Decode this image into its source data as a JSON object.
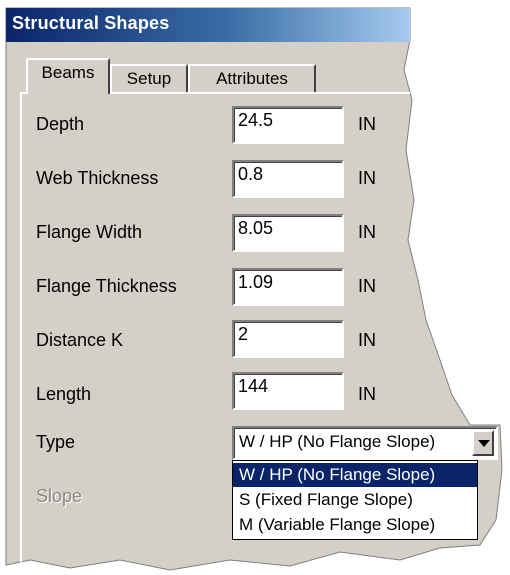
{
  "window": {
    "title": "Structural Shapes"
  },
  "tabs": [
    {
      "label": "Beams",
      "active": true
    },
    {
      "label": "Setup",
      "active": false
    },
    {
      "label": "Attributes",
      "active": false
    }
  ],
  "fields": [
    {
      "label": "Depth",
      "value": "24.5",
      "unit": "IN"
    },
    {
      "label": "Web Thickness",
      "value": "0.8",
      "unit": "IN"
    },
    {
      "label": "Flange Width",
      "value": "8.05",
      "unit": "IN"
    },
    {
      "label": "Flange Thickness",
      "value": "1.09",
      "unit": "IN"
    },
    {
      "label": "Distance K",
      "value": "2",
      "unit": "IN"
    },
    {
      "label": "Length",
      "value": "144",
      "unit": "IN"
    }
  ],
  "type_select": {
    "label": "Type",
    "selected": "W / HP (No Flange Slope)",
    "options": [
      "W / HP (No Flange Slope)",
      "S (Fixed Flange Slope)",
      "M (Variable Flange Slope)"
    ]
  },
  "slope": {
    "label": "Slope",
    "disabled": true
  },
  "colors": {
    "panel": "#d4d0c8",
    "titlebar_start": "#0a246a",
    "titlebar_end": "#a6caf0",
    "selection": "#0a246a"
  }
}
